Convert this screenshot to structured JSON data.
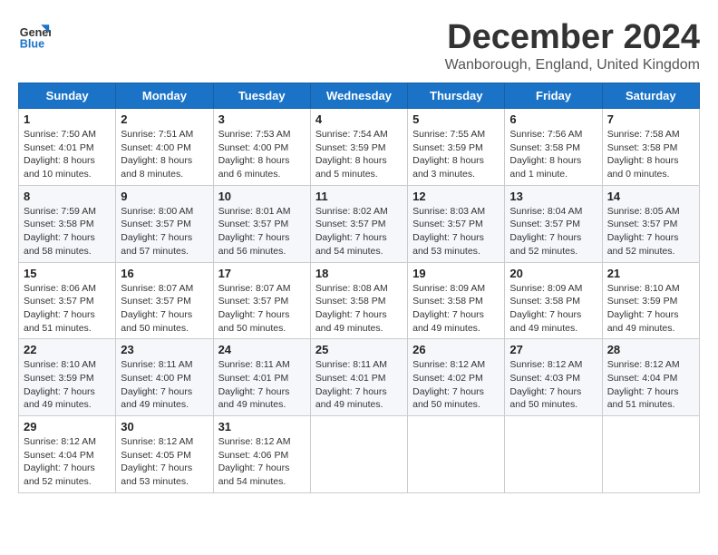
{
  "logo": {
    "line1": "General",
    "line2": "Blue"
  },
  "title": "December 2024",
  "subtitle": "Wanborough, England, United Kingdom",
  "weekdays": [
    "Sunday",
    "Monday",
    "Tuesday",
    "Wednesday",
    "Thursday",
    "Friday",
    "Saturday"
  ],
  "weeks": [
    [
      {
        "day": "1",
        "info": "Sunrise: 7:50 AM\nSunset: 4:01 PM\nDaylight: 8 hours\nand 10 minutes."
      },
      {
        "day": "2",
        "info": "Sunrise: 7:51 AM\nSunset: 4:00 PM\nDaylight: 8 hours\nand 8 minutes."
      },
      {
        "day": "3",
        "info": "Sunrise: 7:53 AM\nSunset: 4:00 PM\nDaylight: 8 hours\nand 6 minutes."
      },
      {
        "day": "4",
        "info": "Sunrise: 7:54 AM\nSunset: 3:59 PM\nDaylight: 8 hours\nand 5 minutes."
      },
      {
        "day": "5",
        "info": "Sunrise: 7:55 AM\nSunset: 3:59 PM\nDaylight: 8 hours\nand 3 minutes."
      },
      {
        "day": "6",
        "info": "Sunrise: 7:56 AM\nSunset: 3:58 PM\nDaylight: 8 hours\nand 1 minute."
      },
      {
        "day": "7",
        "info": "Sunrise: 7:58 AM\nSunset: 3:58 PM\nDaylight: 8 hours\nand 0 minutes."
      }
    ],
    [
      {
        "day": "8",
        "info": "Sunrise: 7:59 AM\nSunset: 3:58 PM\nDaylight: 7 hours\nand 58 minutes."
      },
      {
        "day": "9",
        "info": "Sunrise: 8:00 AM\nSunset: 3:57 PM\nDaylight: 7 hours\nand 57 minutes."
      },
      {
        "day": "10",
        "info": "Sunrise: 8:01 AM\nSunset: 3:57 PM\nDaylight: 7 hours\nand 56 minutes."
      },
      {
        "day": "11",
        "info": "Sunrise: 8:02 AM\nSunset: 3:57 PM\nDaylight: 7 hours\nand 54 minutes."
      },
      {
        "day": "12",
        "info": "Sunrise: 8:03 AM\nSunset: 3:57 PM\nDaylight: 7 hours\nand 53 minutes."
      },
      {
        "day": "13",
        "info": "Sunrise: 8:04 AM\nSunset: 3:57 PM\nDaylight: 7 hours\nand 52 minutes."
      },
      {
        "day": "14",
        "info": "Sunrise: 8:05 AM\nSunset: 3:57 PM\nDaylight: 7 hours\nand 52 minutes."
      }
    ],
    [
      {
        "day": "15",
        "info": "Sunrise: 8:06 AM\nSunset: 3:57 PM\nDaylight: 7 hours\nand 51 minutes."
      },
      {
        "day": "16",
        "info": "Sunrise: 8:07 AM\nSunset: 3:57 PM\nDaylight: 7 hours\nand 50 minutes."
      },
      {
        "day": "17",
        "info": "Sunrise: 8:07 AM\nSunset: 3:57 PM\nDaylight: 7 hours\nand 50 minutes."
      },
      {
        "day": "18",
        "info": "Sunrise: 8:08 AM\nSunset: 3:58 PM\nDaylight: 7 hours\nand 49 minutes."
      },
      {
        "day": "19",
        "info": "Sunrise: 8:09 AM\nSunset: 3:58 PM\nDaylight: 7 hours\nand 49 minutes."
      },
      {
        "day": "20",
        "info": "Sunrise: 8:09 AM\nSunset: 3:58 PM\nDaylight: 7 hours\nand 49 minutes."
      },
      {
        "day": "21",
        "info": "Sunrise: 8:10 AM\nSunset: 3:59 PM\nDaylight: 7 hours\nand 49 minutes."
      }
    ],
    [
      {
        "day": "22",
        "info": "Sunrise: 8:10 AM\nSunset: 3:59 PM\nDaylight: 7 hours\nand 49 minutes."
      },
      {
        "day": "23",
        "info": "Sunrise: 8:11 AM\nSunset: 4:00 PM\nDaylight: 7 hours\nand 49 minutes."
      },
      {
        "day": "24",
        "info": "Sunrise: 8:11 AM\nSunset: 4:01 PM\nDaylight: 7 hours\nand 49 minutes."
      },
      {
        "day": "25",
        "info": "Sunrise: 8:11 AM\nSunset: 4:01 PM\nDaylight: 7 hours\nand 49 minutes."
      },
      {
        "day": "26",
        "info": "Sunrise: 8:12 AM\nSunset: 4:02 PM\nDaylight: 7 hours\nand 50 minutes."
      },
      {
        "day": "27",
        "info": "Sunrise: 8:12 AM\nSunset: 4:03 PM\nDaylight: 7 hours\nand 50 minutes."
      },
      {
        "day": "28",
        "info": "Sunrise: 8:12 AM\nSunset: 4:04 PM\nDaylight: 7 hours\nand 51 minutes."
      }
    ],
    [
      {
        "day": "29",
        "info": "Sunrise: 8:12 AM\nSunset: 4:04 PM\nDaylight: 7 hours\nand 52 minutes."
      },
      {
        "day": "30",
        "info": "Sunrise: 8:12 AM\nSunset: 4:05 PM\nDaylight: 7 hours\nand 53 minutes."
      },
      {
        "day": "31",
        "info": "Sunrise: 8:12 AM\nSunset: 4:06 PM\nDaylight: 7 hours\nand 54 minutes."
      },
      null,
      null,
      null,
      null
    ]
  ]
}
